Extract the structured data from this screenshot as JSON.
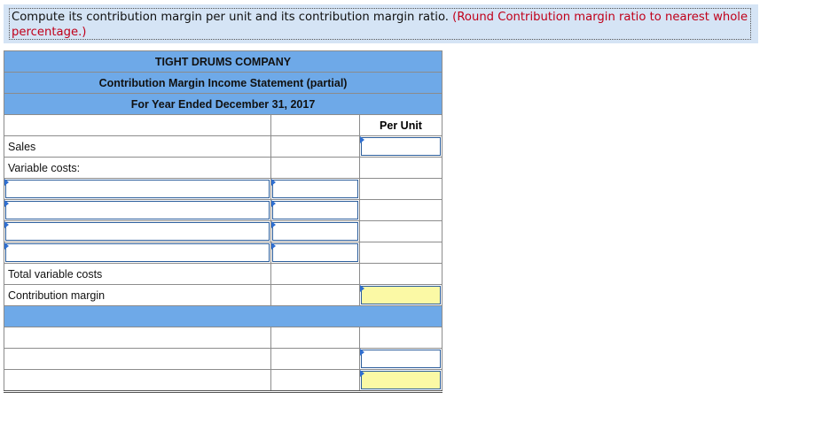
{
  "instruction": {
    "text": "Compute its contribution margin per unit and its contribution margin ratio.",
    "note": "(Round Contribution margin ratio to nearest whole percentage.)"
  },
  "statement": {
    "company": "TIGHT DRUMS COMPANY",
    "title": "Contribution Margin Income Statement (partial)",
    "period": "For Year Ended December 31, 2017",
    "col_per_unit": "Per Unit",
    "rows": {
      "sales": "Sales",
      "variable_costs": "Variable costs:",
      "total_variable_costs": "Total variable costs",
      "contribution_margin": "Contribution margin"
    }
  }
}
